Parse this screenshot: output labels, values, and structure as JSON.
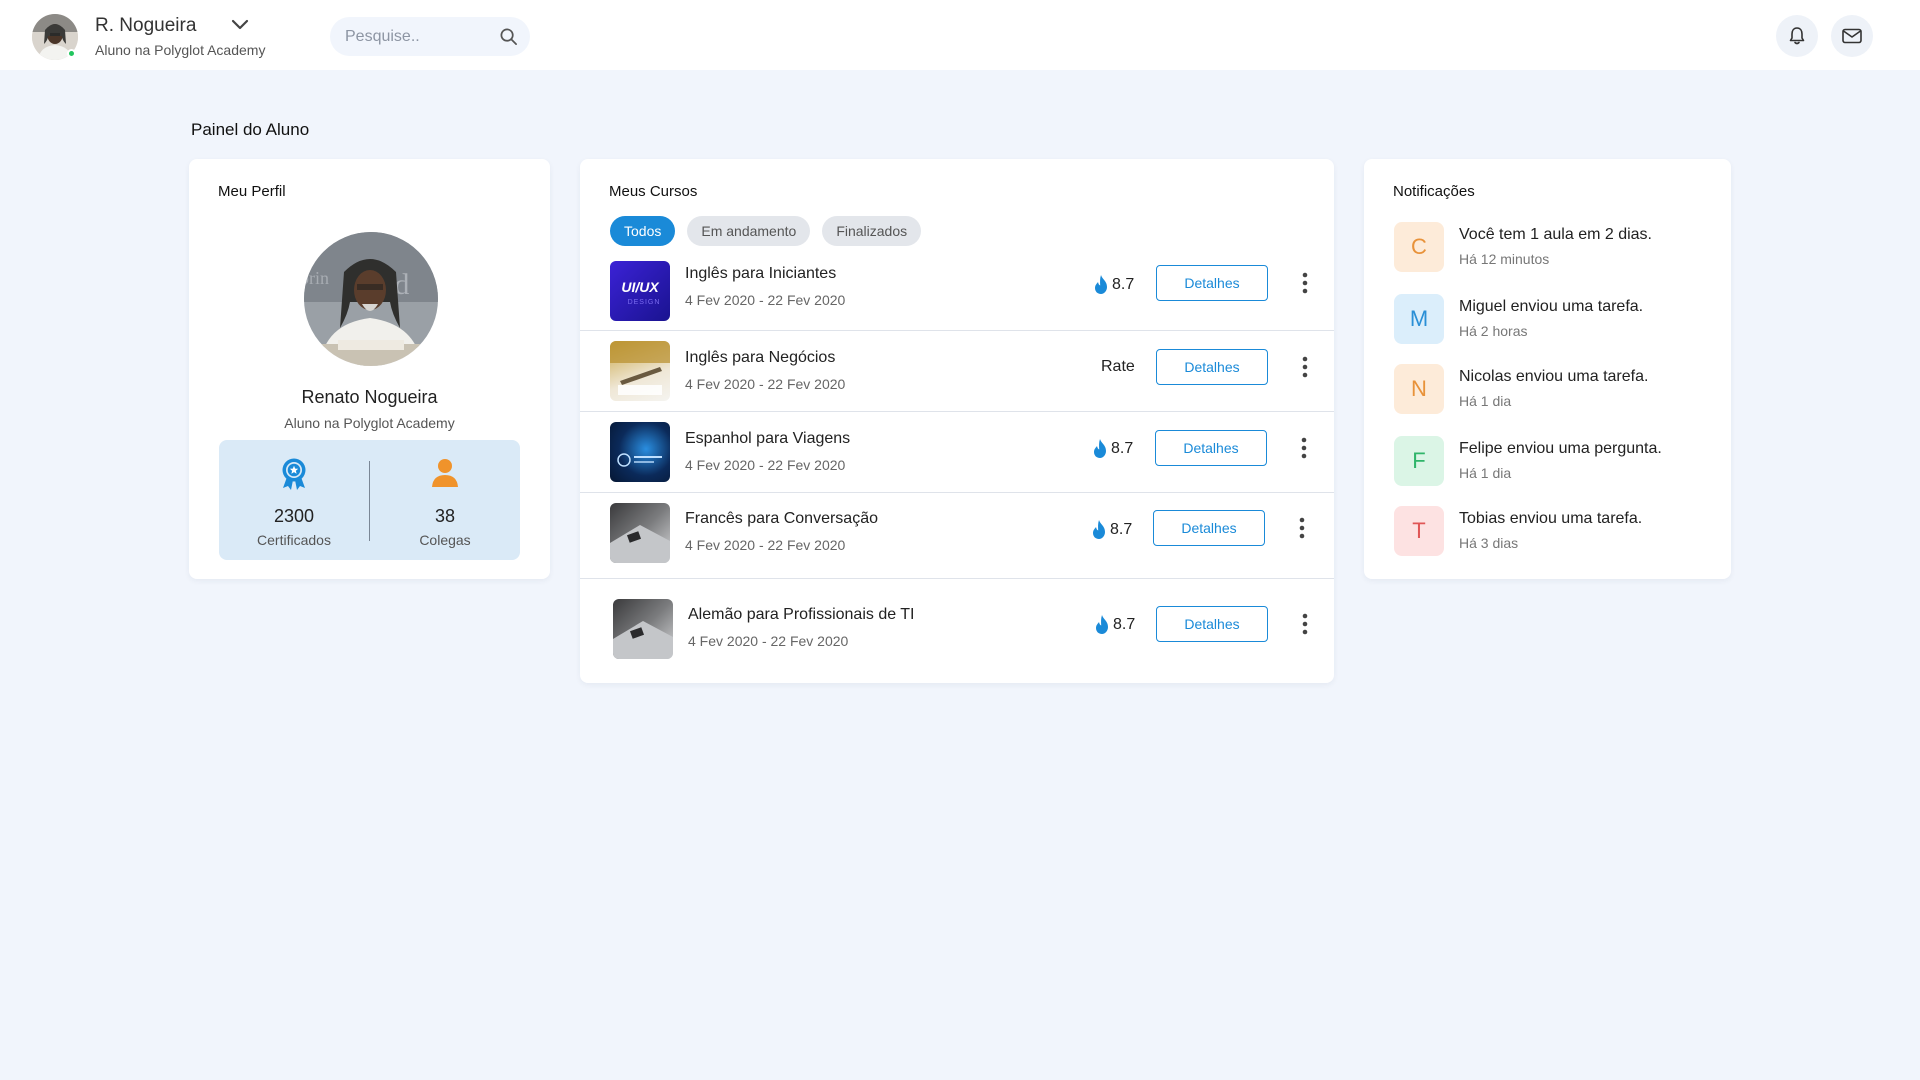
{
  "user": {
    "name": "R. Nogueira",
    "role": "Aluno na Polyglot Academy"
  },
  "search": {
    "placeholder": "Pesquise.."
  },
  "page_title": "Painel do Aluno",
  "profile": {
    "title": "Meu Perfil",
    "name": "Renato Nogueira",
    "role": "Aluno na Polyglot Academy",
    "stats": [
      {
        "value": "2300",
        "label": "Certificados",
        "icon": "award-icon",
        "color": "#1a8ad8"
      },
      {
        "value": "38",
        "label": "Colegas",
        "icon": "person-icon",
        "color": "#f0932b"
      }
    ]
  },
  "courses": {
    "title": "Meus Cursos",
    "tabs": [
      "Todos",
      "Em andamento",
      "Finalizados"
    ],
    "active_tab": "Todos",
    "items": [
      {
        "title": "Inglês para Iniciantes",
        "dates": "4 Fev 2020 - 22 Fev 2020",
        "rating": "8.7",
        "thumb_text": "UI/UX",
        "button": "Detalhes"
      },
      {
        "title": "Inglês para Negócios",
        "dates": "4 Fev 2020 - 22 Fev 2020",
        "rating": "Rate",
        "button": "Detalhes"
      },
      {
        "title": "Espanhol para Viagens",
        "dates": "4 Fev 2020 - 22 Fev 2020",
        "rating": "8.7",
        "button": "Detalhes"
      },
      {
        "title": "Francês para Conversação",
        "dates": "4 Fev 2020 - 22 Fev 2020",
        "rating": "8.7",
        "button": "Detalhes"
      },
      {
        "title": "Alemão para Profissionais de TI",
        "dates": "4 Fev 2020 - 22 Fev 2020",
        "rating": "8.7",
        "button": "Detalhes"
      }
    ]
  },
  "notifications": {
    "title": "Notificações",
    "items": [
      {
        "letter": "C",
        "text": "Você tem 1 aula em 2 dias.",
        "time": "Há 12 minutos",
        "bg": "#fdebd9",
        "fg": "#e8923a"
      },
      {
        "letter": "M",
        "text": "Miguel enviou uma tarefa.",
        "time": "Há 2 horas",
        "bg": "#dbeefb",
        "fg": "#2a8fd6"
      },
      {
        "letter": "N",
        "text": "Nicolas enviou uma tarefa.",
        "time": "Há 1 dia",
        "bg": "#fdebd9",
        "fg": "#e8923a"
      },
      {
        "letter": "F",
        "text": "Felipe enviou uma pergunta.",
        "time": "Há 1 dia",
        "bg": "#dbf5e6",
        "fg": "#2fb56a"
      },
      {
        "letter": "T",
        "text": "Tobias enviou uma tarefa.",
        "time": "Há 3 dias",
        "bg": "#fde2e2",
        "fg": "#e05656"
      }
    ]
  },
  "colors": {
    "accent": "#1a8ad8",
    "background": "#f1f5fc",
    "stats_bg": "#daeaf7"
  }
}
